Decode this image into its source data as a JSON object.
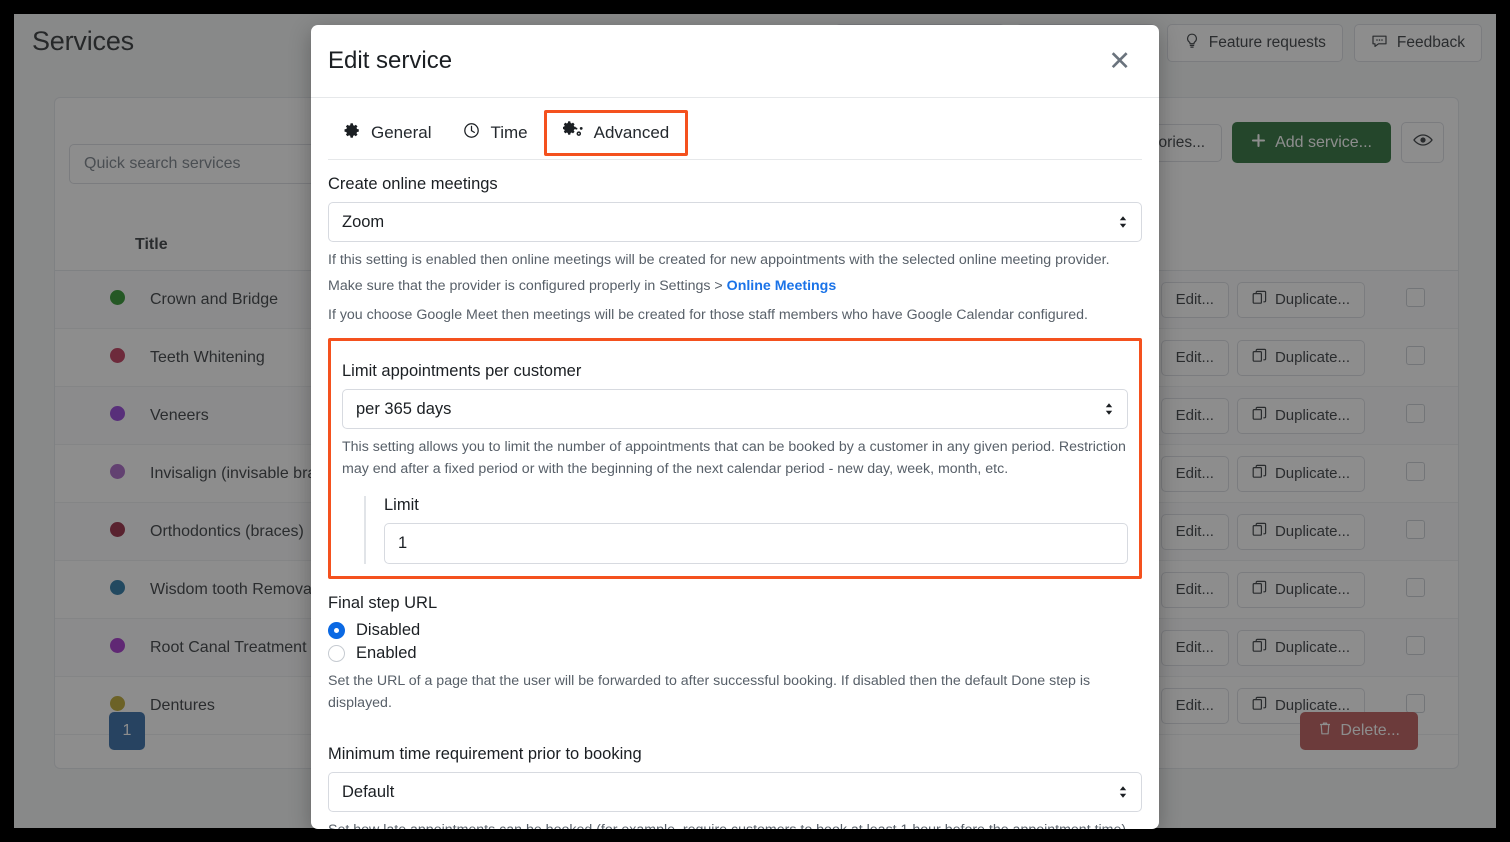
{
  "page": {
    "title": "Services",
    "search_placeholder": "Quick search services",
    "top_buttons": [
      {
        "label": "Feature requests",
        "icon": "lightbulb-icon"
      },
      {
        "label": "Feedback",
        "icon": "comment-icon"
      }
    ],
    "toolbar": {
      "categories_label": "gories...",
      "add_service_label": "Add service...",
      "add_service_icon": "plus-icon",
      "preview_icon": "eye-icon"
    },
    "table": {
      "headers": [
        "",
        "Title",
        "",
        ""
      ],
      "title_header": "Title",
      "rows": [
        {
          "color": "#1a8a1a",
          "title": "Crown and Bridge",
          "edit": "Edit...",
          "duplicate": "Duplicate..."
        },
        {
          "color": "#b8244a",
          "title": "Teeth Whitening",
          "edit": "Edit...",
          "duplicate": "Duplicate..."
        },
        {
          "color": "#8b2fd6",
          "title": "Veneers",
          "edit": "Edit...",
          "duplicate": "Duplicate..."
        },
        {
          "color": "#a158c0",
          "title": "Invisalign (invisable brac",
          "edit": "Edit...",
          "duplicate": "Duplicate..."
        },
        {
          "color": "#8c1230",
          "title": "Orthodontics (braces)",
          "edit": "Edit...",
          "duplicate": "Duplicate..."
        },
        {
          "color": "#12699c",
          "title": "Wisdom tooth Removal",
          "edit": "Edit...",
          "duplicate": "Duplicate..."
        },
        {
          "color": "#9b20c7",
          "title": "Root Canal Treatment",
          "edit": "Edit...",
          "duplicate": "Duplicate..."
        },
        {
          "color": "#b7a01e",
          "title": "Dentures",
          "edit": "Edit...",
          "duplicate": "Duplicate..."
        }
      ]
    },
    "pagination_current": "1",
    "delete_label": "Delete...",
    "delete_icon": "trash-icon"
  },
  "modal": {
    "title": "Edit service",
    "close_icon": "close-icon",
    "tabs": [
      {
        "label": "General",
        "icon": "gear-icon",
        "active": false
      },
      {
        "label": "Time",
        "icon": "clock-icon",
        "active": false
      },
      {
        "label": "Advanced",
        "icon": "gears-icon",
        "active": true
      }
    ],
    "sections": {
      "online_meetings": {
        "label": "Create online meetings",
        "select_value": "Zoom",
        "help_1": "If this setting is enabled then online meetings will be created for new appointments with the selected online meeting provider.",
        "help_2_prefix": "Make sure that the provider is configured properly in Settings > ",
        "help_2_link": "Online Meetings",
        "help_3": "If you choose Google Meet then meetings will be created for those staff members who have Google Calendar configured."
      },
      "limit_appointments": {
        "label": "Limit appointments per customer",
        "select_value": "per 365 days",
        "help": "This setting allows you to limit the number of appointments that can be booked by a customer in any given period. Restriction may end after a fixed period or with the beginning of the next calendar period - new day, week, month, etc.",
        "limit_label": "Limit",
        "limit_value": "1",
        "highlighted": true
      },
      "final_step_url": {
        "label": "Final step URL",
        "options": [
          {
            "label": "Disabled",
            "selected": true
          },
          {
            "label": "Enabled",
            "selected": false
          }
        ],
        "help": "Set the URL of a page that the user will be forwarded to after successful booking. If disabled then the default Done step is displayed."
      },
      "minimum_time": {
        "label": "Minimum time requirement prior to booking",
        "select_value": "Default",
        "help": "Set how late appointments can be booked (for example, require customers to book at least 1 hour before the appointment time)."
      }
    }
  },
  "colors": {
    "accent_orange": "#f4511e",
    "link_blue": "#1a73e8",
    "primary_green": "#176327",
    "radio_blue": "#0b69e3",
    "pagination_blue": "#1d5c9e",
    "delete_red": "#b54a4a"
  }
}
